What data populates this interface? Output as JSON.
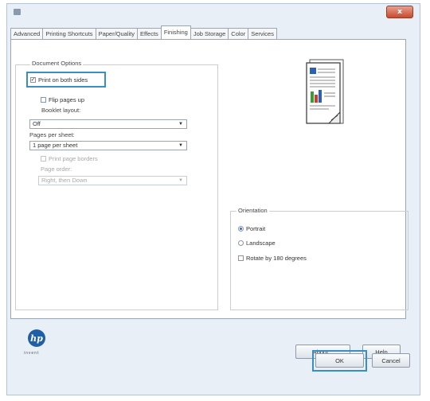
{
  "window": {
    "close_label": "x"
  },
  "tabs": [
    "Advanced",
    "Printing Shortcuts",
    "Paper/Quality",
    "Effects",
    "Finishing",
    "Job Storage",
    "Color",
    "Services"
  ],
  "active_tab": "Finishing",
  "document_options": {
    "title": "Document Options",
    "print_both_sides": {
      "label": "Print on both sides",
      "checked": true
    },
    "flip_pages_up": {
      "label": "Flip pages up",
      "checked": false
    },
    "booklet_layout_label": "Booklet layout:",
    "booklet_layout_value": "Off",
    "pages_per_sheet_label": "Pages per sheet:",
    "pages_per_sheet_value": "1 page per sheet",
    "print_page_borders": {
      "label": "Print page borders",
      "checked": false
    },
    "page_order_label": "Page order:",
    "page_order_value": "Right, then Down"
  },
  "orientation": {
    "title": "Orientation",
    "portrait": "Portrait",
    "landscape": "Landscape",
    "selected": "Portrait",
    "rotate": {
      "label": "Rotate by 180 degrees",
      "checked": false
    }
  },
  "buttons": {
    "about": "About...",
    "help": "Help",
    "ok": "OK",
    "cancel": "Cancel"
  },
  "logo": {
    "text": "hp",
    "caption": "invent"
  },
  "colors": {
    "highlight": "#3b8ec4",
    "radio_selected": "#2b6cb6",
    "hp_blue": "#1f5fa8",
    "chart_green": "#3c9a3a",
    "chart_red": "#d23a2a",
    "chart_blue": "#2d5fb3"
  },
  "icons": [
    "app-icon",
    "close-icon",
    "dropdown-arrow-icon",
    "document-preview-icon",
    "hp-logo-icon"
  ]
}
